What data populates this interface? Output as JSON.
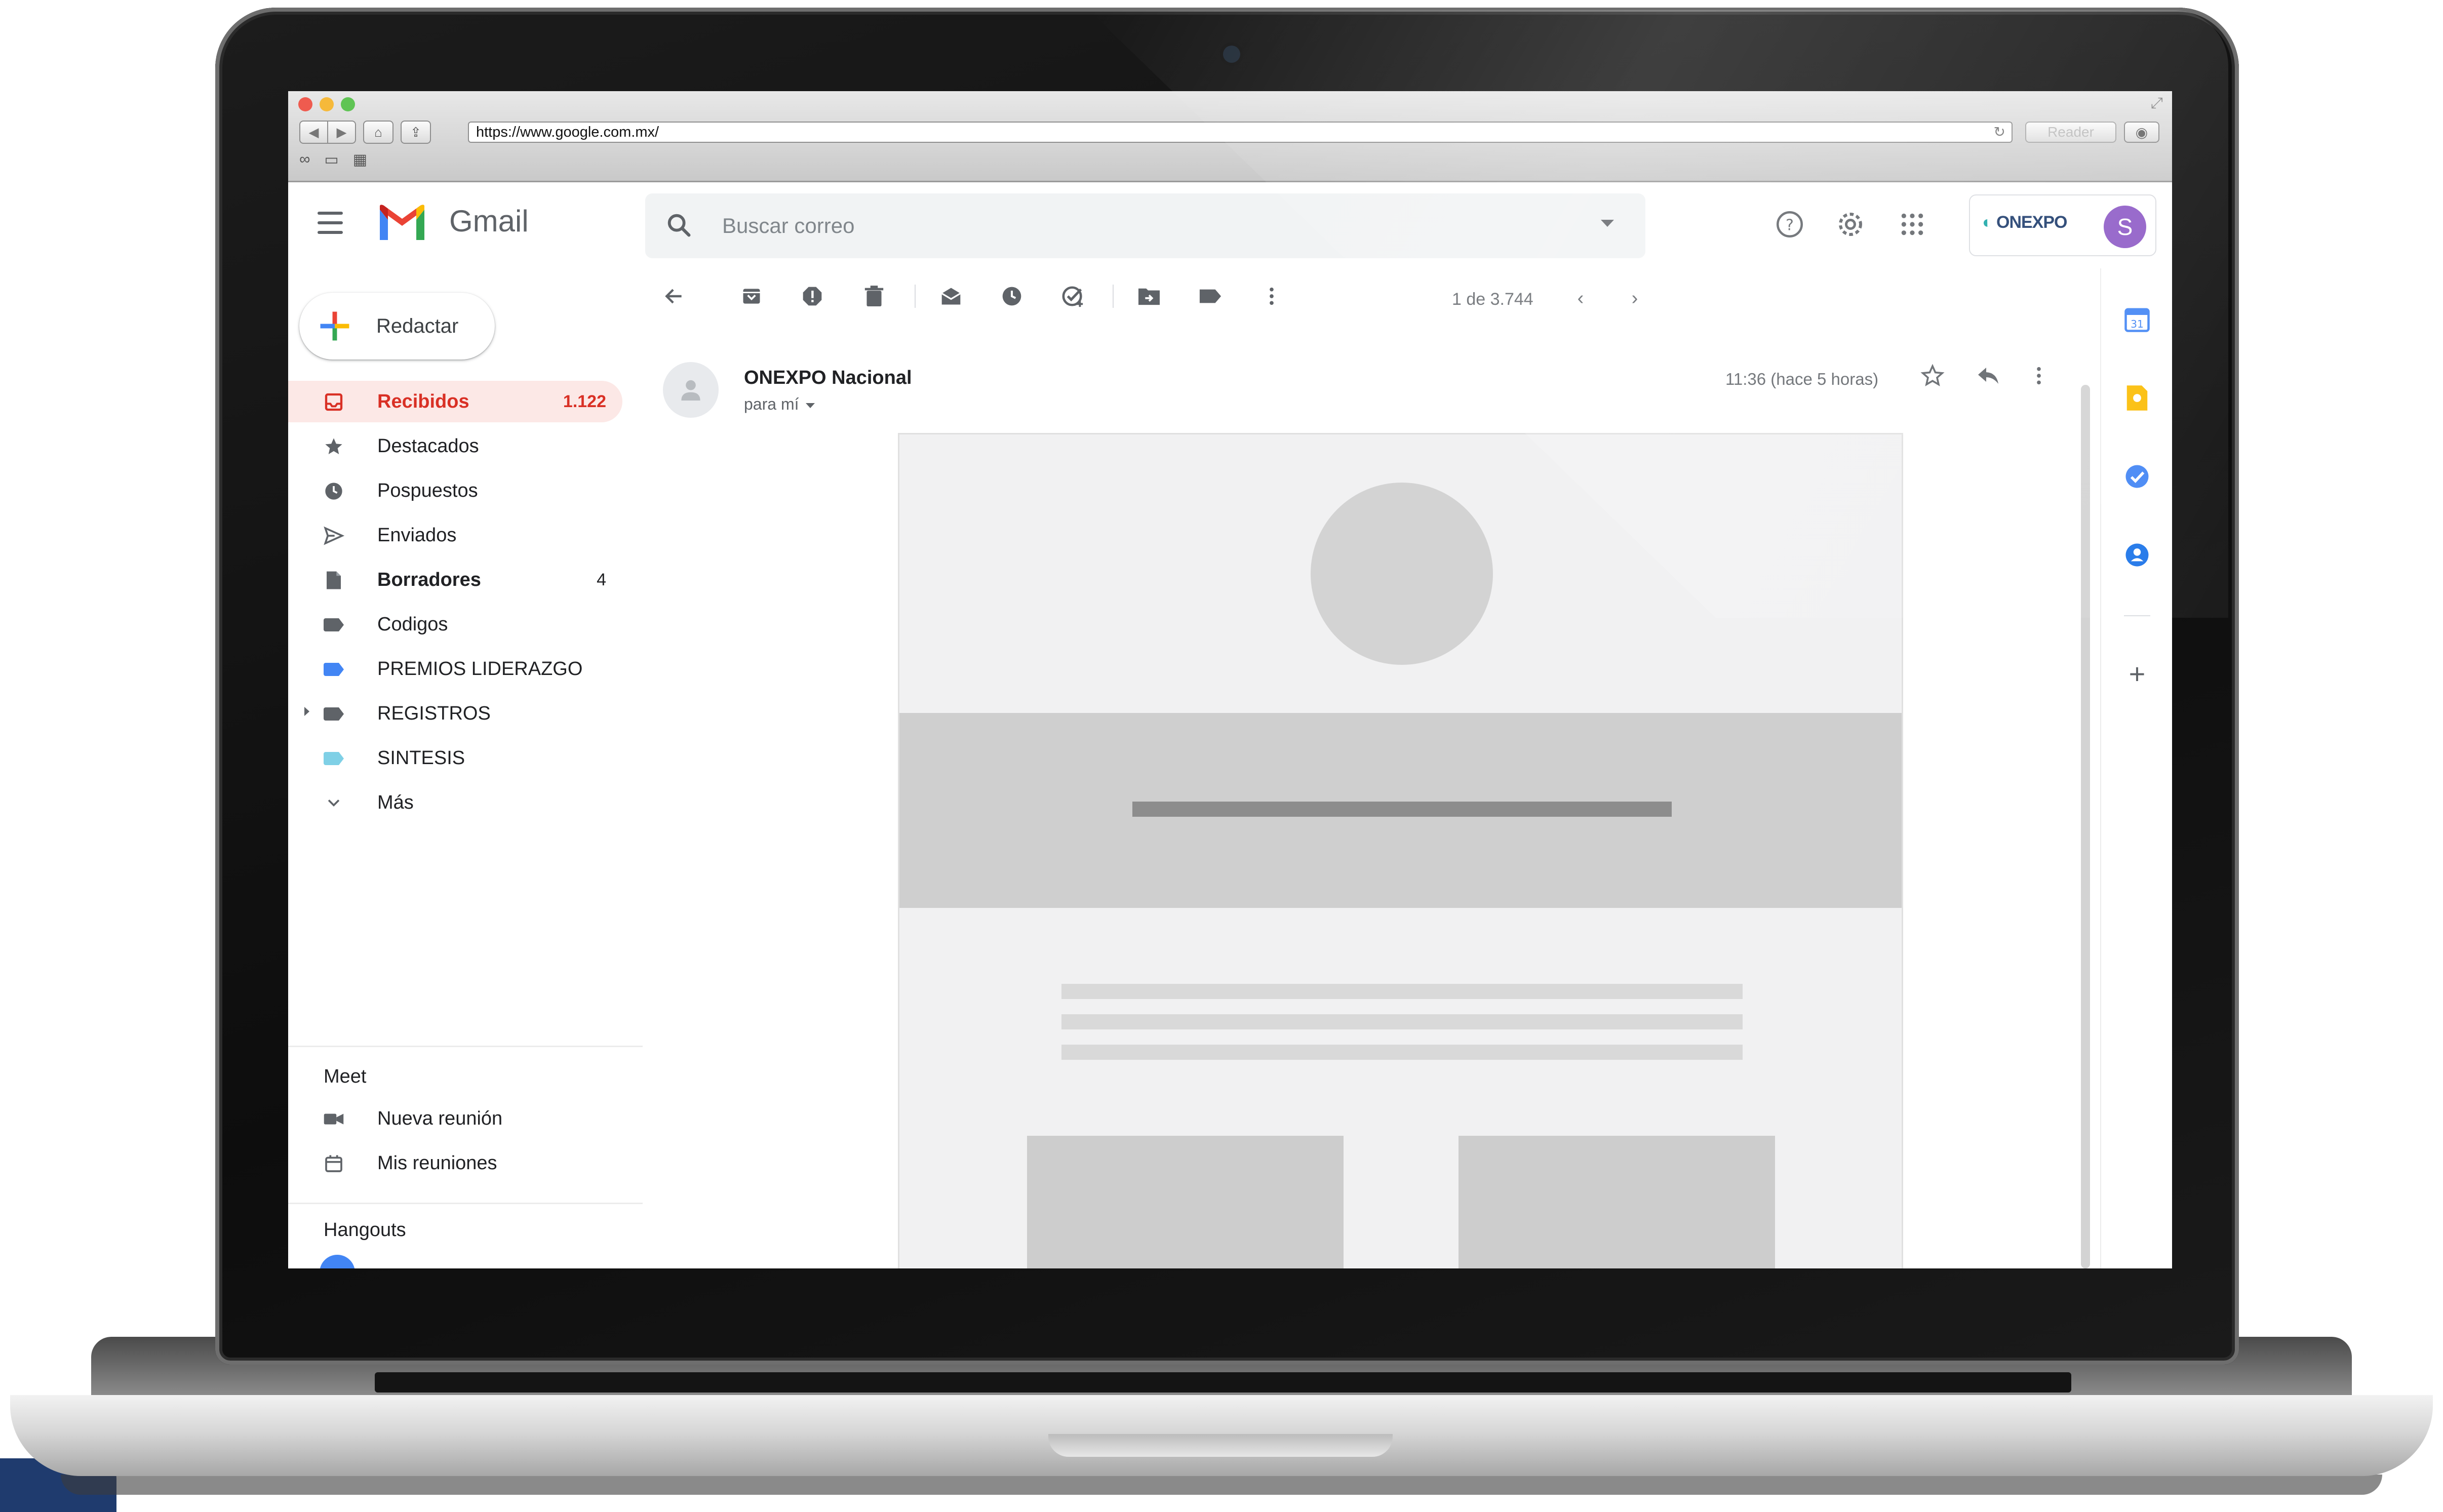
{
  "browser": {
    "url": "https://www.google.com.mx/",
    "reader_label": "Reader"
  },
  "app": {
    "name": "Gmail"
  },
  "search": {
    "placeholder": "Buscar correo"
  },
  "account": {
    "org_logo_text": "ONEXPO",
    "avatar_initial": "S"
  },
  "compose": {
    "label": "Redactar"
  },
  "sidebar": {
    "items": [
      {
        "label": "Recibidos",
        "count": "1.122",
        "icon": "inbox-icon"
      },
      {
        "label": "Destacados",
        "count": "",
        "icon": "star-icon"
      },
      {
        "label": "Pospuestos",
        "count": "",
        "icon": "clock-icon"
      },
      {
        "label": "Enviados",
        "count": "",
        "icon": "send-icon"
      },
      {
        "label": "Borradores",
        "count": "4",
        "icon": "draft-icon"
      },
      {
        "label": "Codigos",
        "count": "",
        "icon": "label-icon",
        "color": "#5f6368"
      },
      {
        "label": "PREMIOS LIDERAZGO",
        "count": "",
        "icon": "label-icon",
        "color": "#4285f4"
      },
      {
        "label": "REGISTROS",
        "count": "",
        "icon": "label-icon",
        "color": "#5f6368"
      },
      {
        "label": "SINTESIS",
        "count": "",
        "icon": "label-icon",
        "color": "#7fd0e6"
      },
      {
        "label": "Más",
        "count": "",
        "icon": "chevron-down-icon"
      }
    ]
  },
  "meet": {
    "title": "Meet",
    "new_meeting": "Nueva reunión",
    "my_meetings": "Mis reuniones"
  },
  "hangouts": {
    "title": "Hangouts"
  },
  "pager": {
    "text": "1 de 3.744"
  },
  "message": {
    "sender": "ONEXPO Nacional",
    "to": "para mí",
    "time": "11:36 (hace 5 horas)"
  },
  "colors": {
    "accent_red": "#d93025",
    "active_bg": "#fce8e6",
    "avatar": "#8e5bc6",
    "corner_accent": "#1f3b6e"
  }
}
